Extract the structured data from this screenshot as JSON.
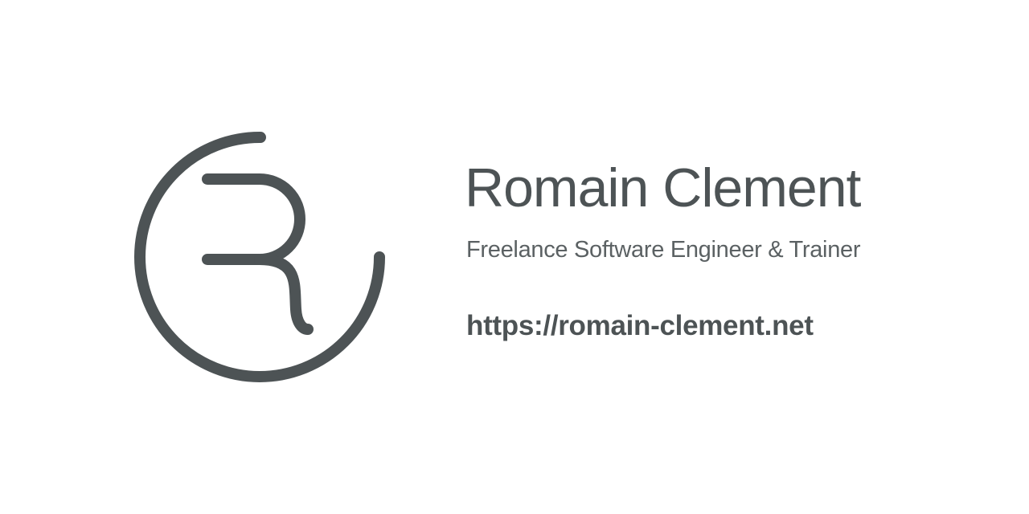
{
  "brand": {
    "name": "Romain Clement",
    "tagline": "Freelance Software Engineer & Trainer",
    "url": "https://romain-clement.net",
    "logo_letter": "R"
  },
  "colors": {
    "background": "#ffffff",
    "primary": "#4d5355",
    "secondary": "#5b6163"
  }
}
